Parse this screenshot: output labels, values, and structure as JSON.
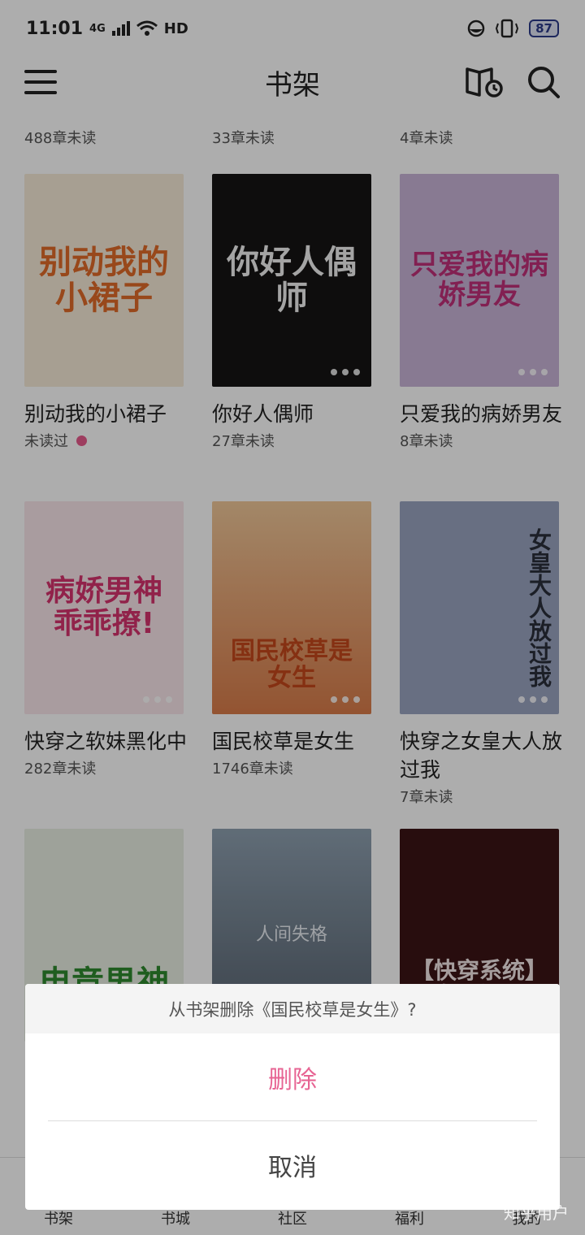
{
  "status_bar": {
    "time": "11:01",
    "network": "4G",
    "hd": "HD",
    "battery": "87"
  },
  "header": {
    "title": "书架"
  },
  "partial_row": [
    "488章未读",
    "33章未读",
    "4章未读"
  ],
  "books": [
    {
      "title": "别动我的小裙子",
      "status": "未读过",
      "unread_dot": true,
      "cover_text": "别动我的小裙子",
      "cover_bg": "#f7ead8",
      "cover_fg": "#e06a28"
    },
    {
      "title": "你好人偶师",
      "status": "27章未读",
      "cover_text": "你好人偶师",
      "cover_bg": "#151414",
      "cover_fg": "#f2f2f2"
    },
    {
      "title": "只爱我的病娇男友",
      "status": "8章未读",
      "cover_text": "只爱我的病娇男友",
      "cover_bg": "#c9b4d8",
      "cover_fg": "#c0307a"
    },
    {
      "title": "快穿之软妹黑化中",
      "status": "282章未读",
      "cover_text": "病娇男神乖乖撩!",
      "cover_bg": "#f9e6ea",
      "cover_fg": "#d6336e"
    },
    {
      "title": "国民校草是女生",
      "status": "1746章未读",
      "cover_text": "国民校草是女生",
      "cover_bg": "#f0c89a",
      "cover_fg": "#c4471b"
    },
    {
      "title": "快穿之女皇大人放过我",
      "status": "7章未读",
      "cover_text": "女皇大人放过我",
      "cover_bg": "#9aa4c0",
      "cover_fg": "#2a2f3a"
    },
    {
      "title": "",
      "status": "",
      "cover_text": "电竞男神",
      "cover_bg": "#e9efe4",
      "cover_fg": "#2f8a2f"
    },
    {
      "title": "",
      "status": "",
      "cover_text": "人间失格",
      "cover_bg": "#6f7f8e",
      "cover_fg": "#e9eef3"
    },
    {
      "title": "",
      "status": "",
      "cover_text": "【快穿系统】女配她是",
      "cover_bg": "#3b1416",
      "cover_fg": "#f3e8e8"
    }
  ],
  "dialog": {
    "message": "从书架删除《国民校草是女生》?",
    "confirm": "删除",
    "cancel": "取消"
  },
  "tabs": [
    "书架",
    "书城",
    "社区",
    "福利",
    "我的"
  ],
  "watermark": "知乎用户"
}
